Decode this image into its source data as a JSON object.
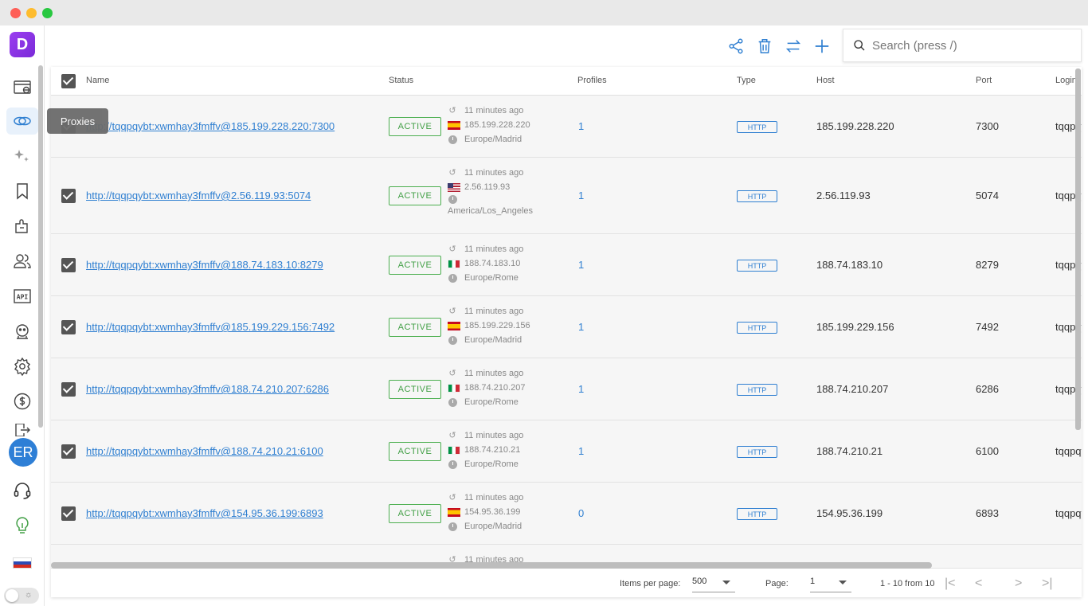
{
  "window": {
    "buttons": [
      "close",
      "minimize",
      "maximize"
    ]
  },
  "sidebar": {
    "logo_letter": "D",
    "items": [
      {
        "name": "browser-profiles-icon"
      },
      {
        "name": "proxies-icon"
      },
      {
        "name": "automation-sparkle-icon"
      },
      {
        "name": "bookmark-icon"
      },
      {
        "name": "extensions-icon"
      },
      {
        "name": "team-icon"
      },
      {
        "name": "api-icon"
      },
      {
        "name": "robot-icon"
      },
      {
        "name": "settings-gear-icon"
      },
      {
        "name": "billing-dollar-icon"
      },
      {
        "name": "logout-icon"
      }
    ],
    "api_label": "API",
    "avatar_initials": "ER",
    "tooltip": "Proxies"
  },
  "toolbar": {
    "icons": [
      "share-icon",
      "trash-icon",
      "swap-icon",
      "plus-icon"
    ],
    "search_placeholder": "Search (press /)"
  },
  "table": {
    "columns": [
      "Name",
      "Status",
      "Profiles",
      "Type",
      "Host",
      "Port",
      "Login"
    ],
    "rows": [
      {
        "name": "http://tqqpqybt:xwmhay3fmffv@185.199.228.220:7300",
        "status": "ACTIVE",
        "checked_ago": "11 minutes ago",
        "ip": "185.199.228.220",
        "country": "es",
        "timezone": "Europe/Madrid",
        "profiles": "1",
        "type": "HTTP",
        "host": "185.199.228.220",
        "port": "7300",
        "login": "tqqpqybt"
      },
      {
        "name": "http://tqqpqybt:xwmhay3fmffv@2.56.119.93:5074",
        "status": "ACTIVE",
        "checked_ago": "11 minutes ago",
        "ip": "2.56.119.93",
        "country": "us",
        "timezone": "America/Los_Angeles",
        "profiles": "1",
        "type": "HTTP",
        "host": "2.56.119.93",
        "port": "5074",
        "login": "tqqpqybt"
      },
      {
        "name": "http://tqqpqybt:xwmhay3fmffv@188.74.183.10:8279",
        "status": "ACTIVE",
        "checked_ago": "11 minutes ago",
        "ip": "188.74.183.10",
        "country": "it",
        "timezone": "Europe/Rome",
        "profiles": "1",
        "type": "HTTP",
        "host": "188.74.183.10",
        "port": "8279",
        "login": "tqqpqybt"
      },
      {
        "name": "http://tqqpqybt:xwmhay3fmffv@185.199.229.156:7492",
        "status": "ACTIVE",
        "checked_ago": "11 minutes ago",
        "ip": "185.199.229.156",
        "country": "es",
        "timezone": "Europe/Madrid",
        "profiles": "1",
        "type": "HTTP",
        "host": "185.199.229.156",
        "port": "7492",
        "login": "tqqpqybt"
      },
      {
        "name": "http://tqqpqybt:xwmhay3fmffv@188.74.210.207:6286",
        "status": "ACTIVE",
        "checked_ago": "11 minutes ago",
        "ip": "188.74.210.207",
        "country": "it",
        "timezone": "Europe/Rome",
        "profiles": "1",
        "type": "HTTP",
        "host": "188.74.210.207",
        "port": "6286",
        "login": "tqqpqybt"
      },
      {
        "name": "http://tqqpqybt:xwmhay3fmffv@188.74.210.21:6100",
        "status": "ACTIVE",
        "checked_ago": "11 minutes ago",
        "ip": "188.74.210.21",
        "country": "it",
        "timezone": "Europe/Rome",
        "profiles": "1",
        "type": "HTTP",
        "host": "188.74.210.21",
        "port": "6100",
        "login": "tqqpqybt"
      },
      {
        "name": "http://tqqpqybt:xwmhay3fmffv@154.95.36.199:6893",
        "status": "ACTIVE",
        "checked_ago": "11 minutes ago",
        "ip": "154.95.36.199",
        "country": "es",
        "timezone": "Europe/Madrid",
        "profiles": "0",
        "type": "HTTP",
        "host": "154.95.36.199",
        "port": "6893",
        "login": "tqqpqybt"
      }
    ],
    "partial_row_text": "11 minutes ago"
  },
  "pagination": {
    "items_per_page_label": "Items per page:",
    "items_per_page": "500",
    "page_label": "Page:",
    "page": "1",
    "range": "1 - 10 from 10"
  },
  "colors": {
    "accent": "#2f7fd1",
    "active": "#43a047",
    "logo": "#8b36e6"
  }
}
